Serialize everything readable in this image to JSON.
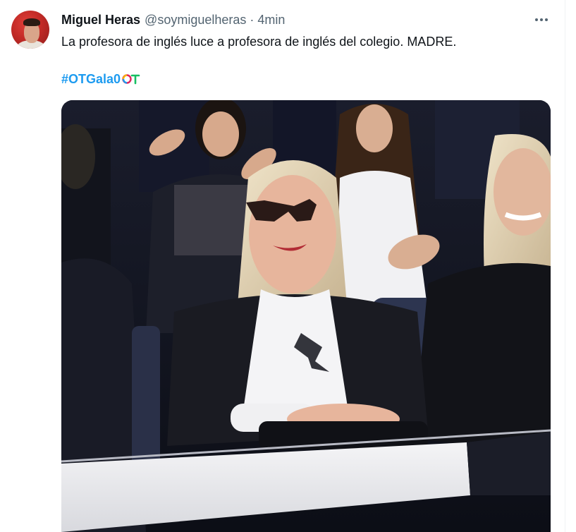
{
  "tweet": {
    "author_name": "Miguel Heras",
    "handle": "@soymiguelheras",
    "separator": "·",
    "time": "4min",
    "text": "La profesora de inglés luce a profesora de inglés del colegio. MADRE.",
    "hashtag": "#OTGala0",
    "hashtag_emoji": "ot-logo-icon"
  },
  "colors": {
    "link": "#1d9bf0",
    "secondary_text": "#536471",
    "primary_text": "#0f1419"
  }
}
